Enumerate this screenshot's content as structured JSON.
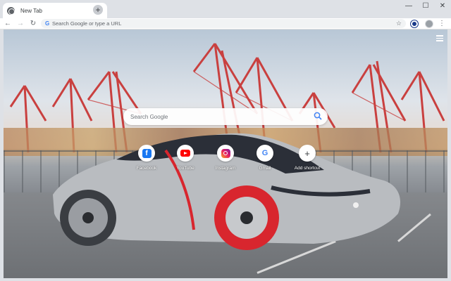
{
  "tab": {
    "title": "New Tab",
    "close_glyph": "×",
    "favicon": "globe-icon"
  },
  "newtab_glyph": "+",
  "window_controls": {
    "minimize": "—",
    "maximize": "☐",
    "close": "✕"
  },
  "toolbar": {
    "back": "←",
    "forward": "→",
    "reload": "↻",
    "omnibox_placeholder": "Search Google or type a URL",
    "omnibox_value": "",
    "bookmark_glyph": "☆",
    "menu_glyph": "⋮"
  },
  "ntp": {
    "search_placeholder": "Search Google",
    "shortcuts": [
      {
        "label": "Facebook",
        "icon": "facebook-icon"
      },
      {
        "label": "YouTube",
        "icon": "youtube-icon"
      },
      {
        "label": "Instagram",
        "icon": "instagram-icon"
      },
      {
        "label": "Gmail",
        "icon": "google-icon"
      },
      {
        "label": "Add shortcut",
        "icon": "plus-icon"
      }
    ],
    "fb_glyph": "f",
    "g_glyph": "G",
    "add_glyph": "+"
  },
  "colors": {
    "tabstrip_bg": "#dee1e6",
    "accent_red": "#d8262e",
    "car_body": "#b9bcc0",
    "car_roof": "#2b2f38"
  }
}
